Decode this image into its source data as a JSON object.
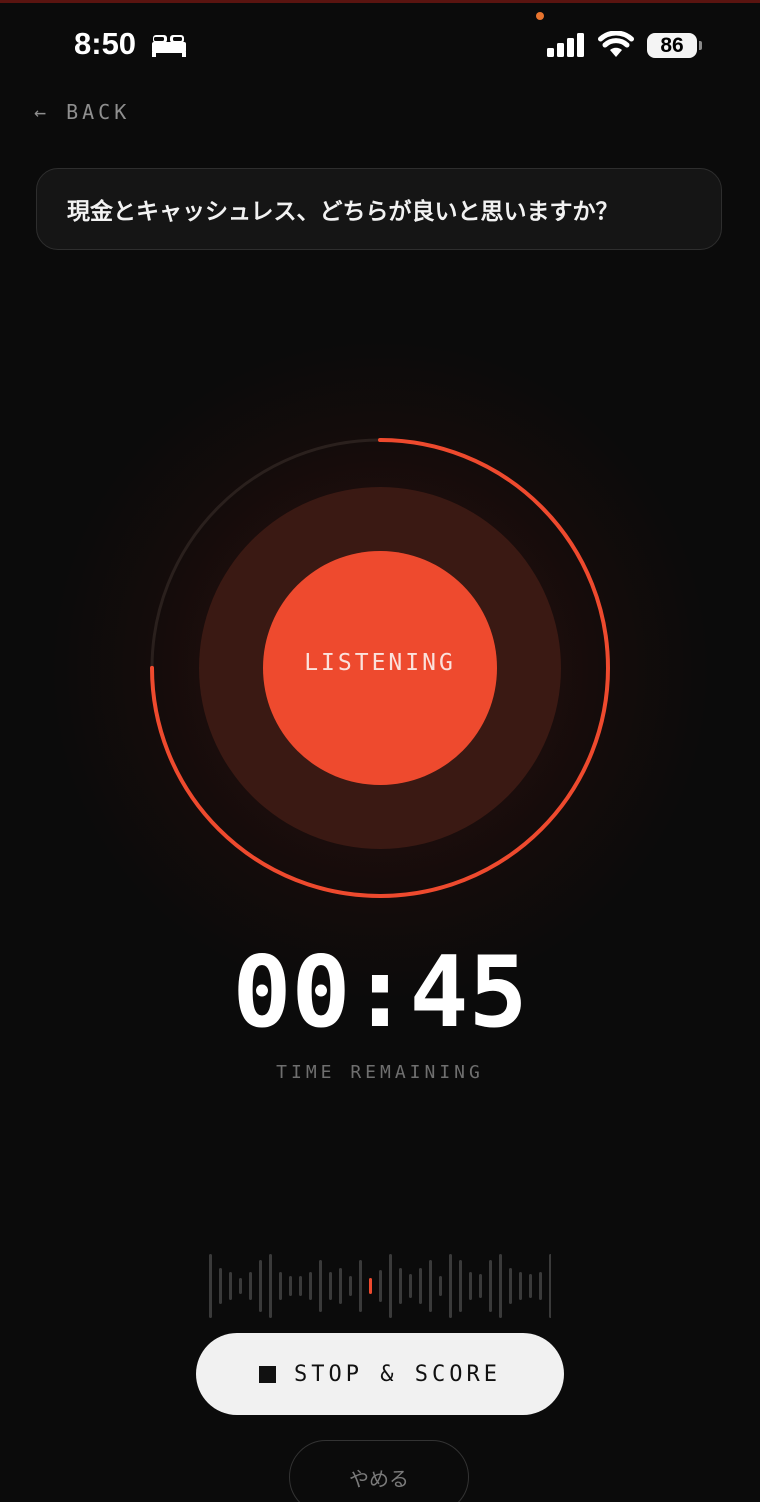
{
  "status_bar": {
    "time": "8:50",
    "sleep_icon": "bed-icon",
    "signal_icon": "cellular-signal-icon",
    "wifi_icon": "wifi-icon",
    "battery": "86"
  },
  "nav": {
    "back_label": "← BACK"
  },
  "question": {
    "text": "現金とキャッシュレス、どちらが良いと思いますか？"
  },
  "recorder": {
    "state_label": "LISTENING",
    "progress_fraction": 0.75,
    "timer": "00:45",
    "timer_caption": "TIME REMAINING"
  },
  "waveform": {
    "bars": [
      0.8,
      0.45,
      0.35,
      0.2,
      0.35,
      0.65,
      0.8,
      0.35,
      0.25,
      0.25,
      0.35,
      0.65,
      0.35,
      0.45,
      0.25,
      0.65,
      0.2,
      0.4,
      0.8,
      0.45,
      0.3,
      0.45,
      0.65,
      0.25,
      0.8,
      0.65,
      0.35,
      0.3,
      0.65,
      0.8,
      0.45,
      0.35,
      0.3,
      0.35,
      0.8
    ],
    "active_index": 16
  },
  "actions": {
    "stop_icon": "stop-square-icon",
    "stop_label": "STOP & SCORE",
    "quit_label": "やめる"
  },
  "colors": {
    "accent": "#ee4a2e",
    "background": "#0b0b0b",
    "track": "#2a201d",
    "halo": "#3a1913"
  }
}
